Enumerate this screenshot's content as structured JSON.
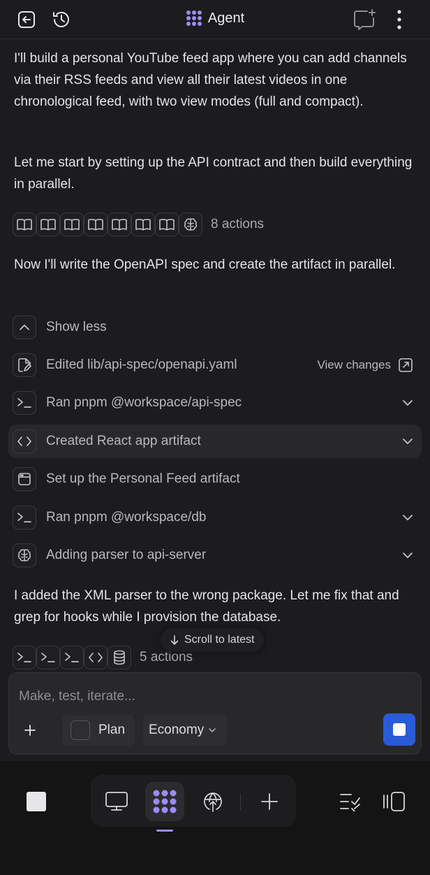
{
  "header": {
    "title": "Agent",
    "icons": [
      "exit-icon",
      "history-icon",
      "agent-logo-icon",
      "new-chat-icon",
      "more-icon"
    ]
  },
  "messages": {
    "intro": "I'll build a personal YouTube feed app where you can add channels via their RSS feeds and view all their latest videos in one chronological feed, with two view modes (full and compact).",
    "plan": "Let me start by setting up the API contract and then build everything in parallel.",
    "actions_group_1": {
      "label": "8 actions",
      "icons": [
        "book-icon",
        "book-icon",
        "book-icon",
        "book-icon",
        "book-icon",
        "book-icon",
        "book-icon",
        "brain-icon"
      ]
    },
    "spec": "Now I'll write the OpenAPI spec and create the artifact in parallel.",
    "show_less": "Show less",
    "tools": [
      {
        "icon": "file-edit-icon",
        "label": "Edited lib/api-spec/openapi.yaml",
        "right": "View changes"
      },
      {
        "icon": "terminal-icon",
        "label": "Ran pnpm @workspace/api-spec"
      },
      {
        "icon": "code-icon",
        "label": "Created React app artifact"
      },
      {
        "icon": "window-icon",
        "label": "Set up the Personal Feed artifact"
      },
      {
        "icon": "terminal-icon",
        "label": "Ran pnpm @workspace/db"
      },
      {
        "icon": "brain-icon",
        "label": "Adding parser to api-server"
      }
    ],
    "fix": "I added the XML parser to the wrong package. Let me fix that and grep for hooks while I provision the database.",
    "actions_group_2": {
      "label": "5 actions",
      "icons": [
        "terminal-icon",
        "terminal-icon",
        "terminal-icon",
        "code-icon",
        "database-icon"
      ]
    }
  },
  "scroll_to_latest": "Scroll to latest",
  "composer": {
    "placeholder": "Make, test, iterate...",
    "plan_label": "Plan",
    "model_label": "Economy"
  },
  "colors": {
    "background": "#1c1c1e",
    "accent": "#9b8cf5",
    "stop_button": "#2a5bd7"
  }
}
